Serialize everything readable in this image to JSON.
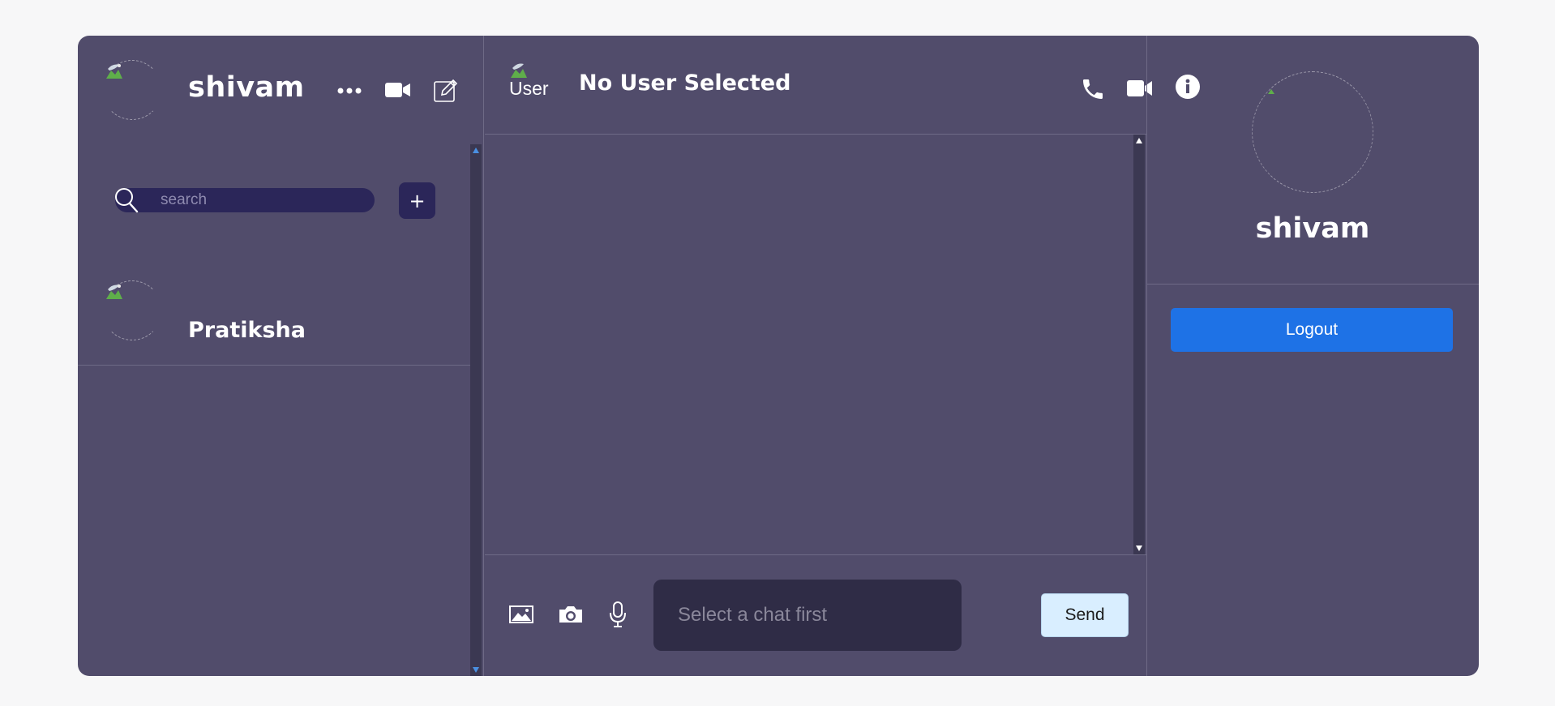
{
  "sidebar": {
    "current_user": {
      "name": "shivam",
      "avatar_icon": "broken-image-icon"
    },
    "header_icons": [
      {
        "name": "more-options-icon",
        "glyph": "•••"
      },
      {
        "name": "video-call-icon"
      },
      {
        "name": "compose-icon"
      }
    ],
    "search": {
      "placeholder": "search",
      "value": ""
    },
    "add_label": "+",
    "contacts": [
      {
        "name": "Pratiksha",
        "avatar_icon": "broken-image-icon"
      }
    ]
  },
  "chat": {
    "header": {
      "avatar_alt": "User",
      "title": "No User Selected"
    },
    "header_icons": [
      "phone-icon",
      "video-call-icon",
      "info-icon"
    ],
    "composer": {
      "placeholder": "Select a chat first",
      "value": "",
      "send_label": "Send",
      "icons": [
        "image-icon",
        "camera-icon",
        "microphone-icon",
        "emoji-icon"
      ]
    }
  },
  "profile": {
    "name": "shivam",
    "logout_label": "Logout"
  },
  "colors": {
    "app_bg": "#514c6b",
    "page_bg": "#f7f7f8",
    "search_bg": "#2b2659",
    "input_bg": "#2f2c46",
    "logout": "#1e72e6",
    "send_bg": "#d9eeff",
    "scroll_arrow": "#4a90e2"
  }
}
